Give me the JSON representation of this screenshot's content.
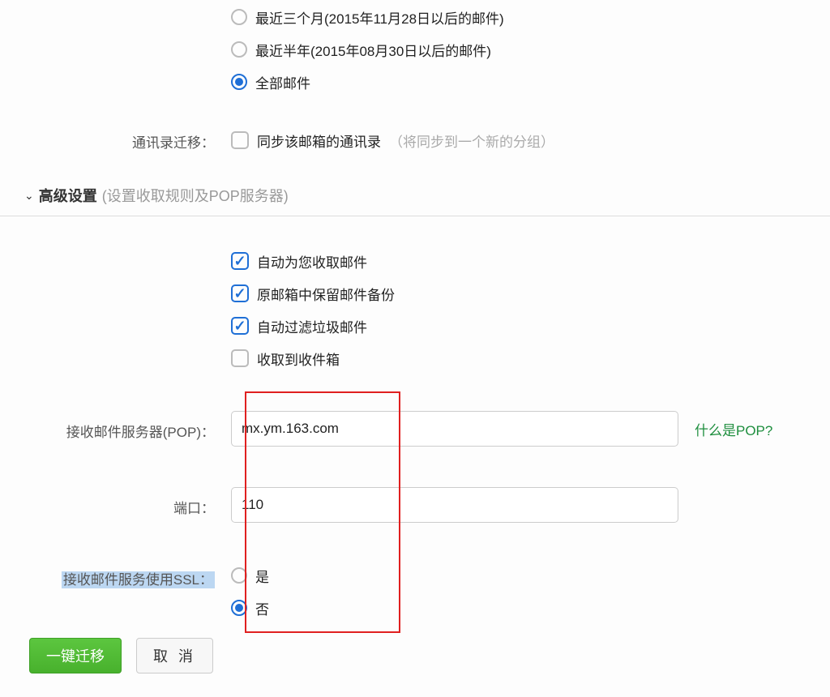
{
  "time_range": {
    "opt_3months": "最近三个月(2015年11月28日以后的邮件)",
    "opt_6months": "最近半年(2015年08月30日以后的邮件)",
    "opt_all": "全部邮件"
  },
  "contacts": {
    "label": "通讯录迁移：",
    "option": "同步该邮箱的通讯录",
    "hint": "（将同步到一个新的分组）"
  },
  "advanced": {
    "caret": "⌄",
    "title": "高级设置",
    "subtitle": "(设置收取规则及POP服务器)",
    "auto_receive": "自动为您收取邮件",
    "keep_backup": "原邮箱中保留邮件备份",
    "filter_spam": "自动过滤垃圾邮件",
    "to_inbox": "收取到收件箱"
  },
  "pop_server": {
    "label": "接收邮件服务器(POP)：",
    "value": "mx.ym.163.com",
    "help": "什么是POP?"
  },
  "port": {
    "label": "端口：",
    "value": "110"
  },
  "ssl": {
    "label": "接收邮件服务使用SSL：",
    "yes": "是",
    "no": "否"
  },
  "buttons": {
    "migrate": "一键迁移",
    "cancel": "取 消"
  }
}
